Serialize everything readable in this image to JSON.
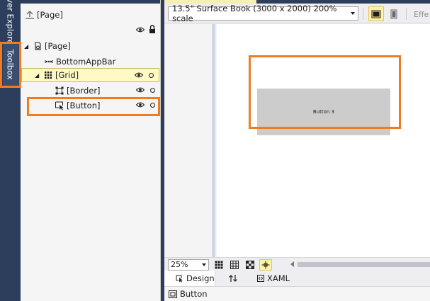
{
  "dock": {
    "explorer_label": "ver Explore",
    "toolbox_label": "Toolbox"
  },
  "outline": {
    "root_label": "[Page]",
    "tree": [
      {
        "label": "[Page]"
      },
      {
        "label": "BottomAppBar"
      },
      {
        "label": "[Grid]"
      },
      {
        "label": "[Border]"
      },
      {
        "label": "[Button]"
      }
    ]
  },
  "designer": {
    "device_label": "13.5\" Surface Book (3000 x 2000) 200% scale",
    "effects_label": "Effe",
    "canvas_button_text": "Button 3",
    "zoom_value": "25%",
    "tabs": [
      {
        "label": "Design"
      },
      {
        "label": "XAML"
      }
    ],
    "breadcrumb_label": "Button"
  },
  "colors": {
    "highlight": "#f07c22",
    "dock": "#2d3e5c",
    "selected_row": "#fff9c4"
  }
}
